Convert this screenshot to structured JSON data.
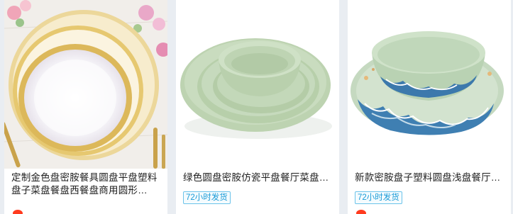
{
  "products": [
    {
      "title": "定制金色盘密胺餐具圆盘平盘塑料盘子菜盘餐盘西餐盘商用圆形…",
      "badge": "",
      "image": "gold-rim-white-plates-icon"
    },
    {
      "title": "绿色圆盘密胺仿瓷平盘餐厅菜盘…",
      "badge": "72小时发货",
      "image": "green-melamine-plates-and-bowl-icon"
    },
    {
      "title": "新款密胺盘子塑料圆盘浅盘餐厅…",
      "badge": "72小时发货",
      "image": "green-wave-pattern-plate-icon"
    }
  ],
  "colors": {
    "badge_text": "#1a9bd7",
    "badge_border": "#6cc3ea",
    "price_accent": "#ff3b1f",
    "page_background": "#e9edf2"
  }
}
